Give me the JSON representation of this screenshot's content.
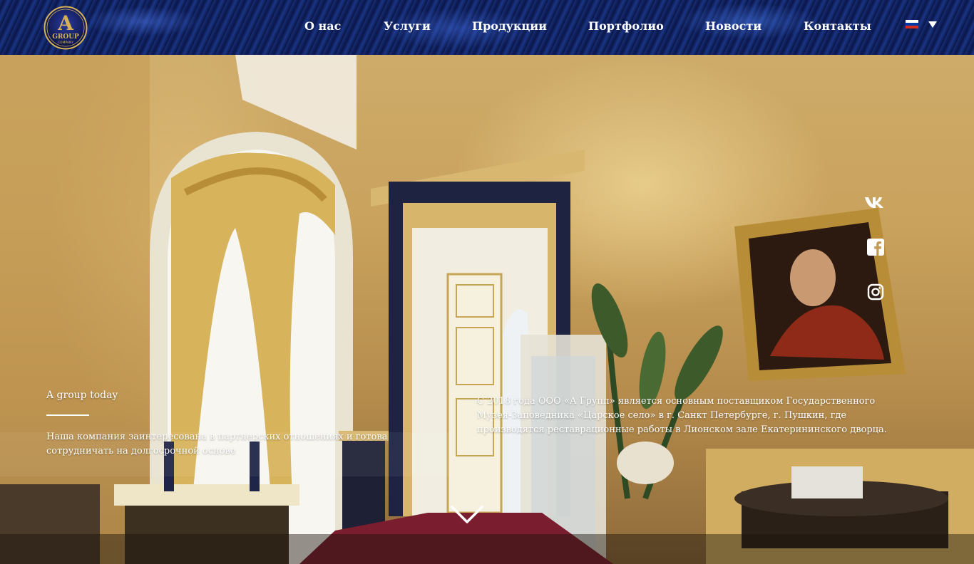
{
  "brand": {
    "logo_letter": "A",
    "logo_word": "GROUP",
    "logo_sub": "COMPANY"
  },
  "nav": {
    "items": [
      {
        "label": "О нас"
      },
      {
        "label": "Услуги"
      },
      {
        "label": "Продукции"
      },
      {
        "label": "Портфолио"
      },
      {
        "label": "Новости"
      },
      {
        "label": "Контакты"
      }
    ]
  },
  "language": {
    "flag_colors": [
      "#ffffff",
      "#0039a6",
      "#d52b1e"
    ],
    "icon": "caret-down-icon"
  },
  "social": {
    "items": [
      {
        "icon": "vk-icon"
      },
      {
        "icon": "facebook-icon"
      },
      {
        "icon": "instagram-icon"
      }
    ]
  },
  "intro": {
    "label": "A group today",
    "text": "Наша компания заинтересована в партнерских отношениях и готова сотрудничать на долгосрочной основе"
  },
  "about": {
    "text": "С 2018 года ООО «А Групп» является основным поставщиком Государственного Музея-Заповедника «Царское село» в г. Санкт Петербурге, г. Пушкин, где производятся реставрационные работы в Лионском зале Екатерининского дворца."
  },
  "scroll": {
    "icon": "chevron-down-icon"
  },
  "colors": {
    "header": "#0c1a4d",
    "gold": "#c9a25d",
    "text": "#ffffff"
  }
}
